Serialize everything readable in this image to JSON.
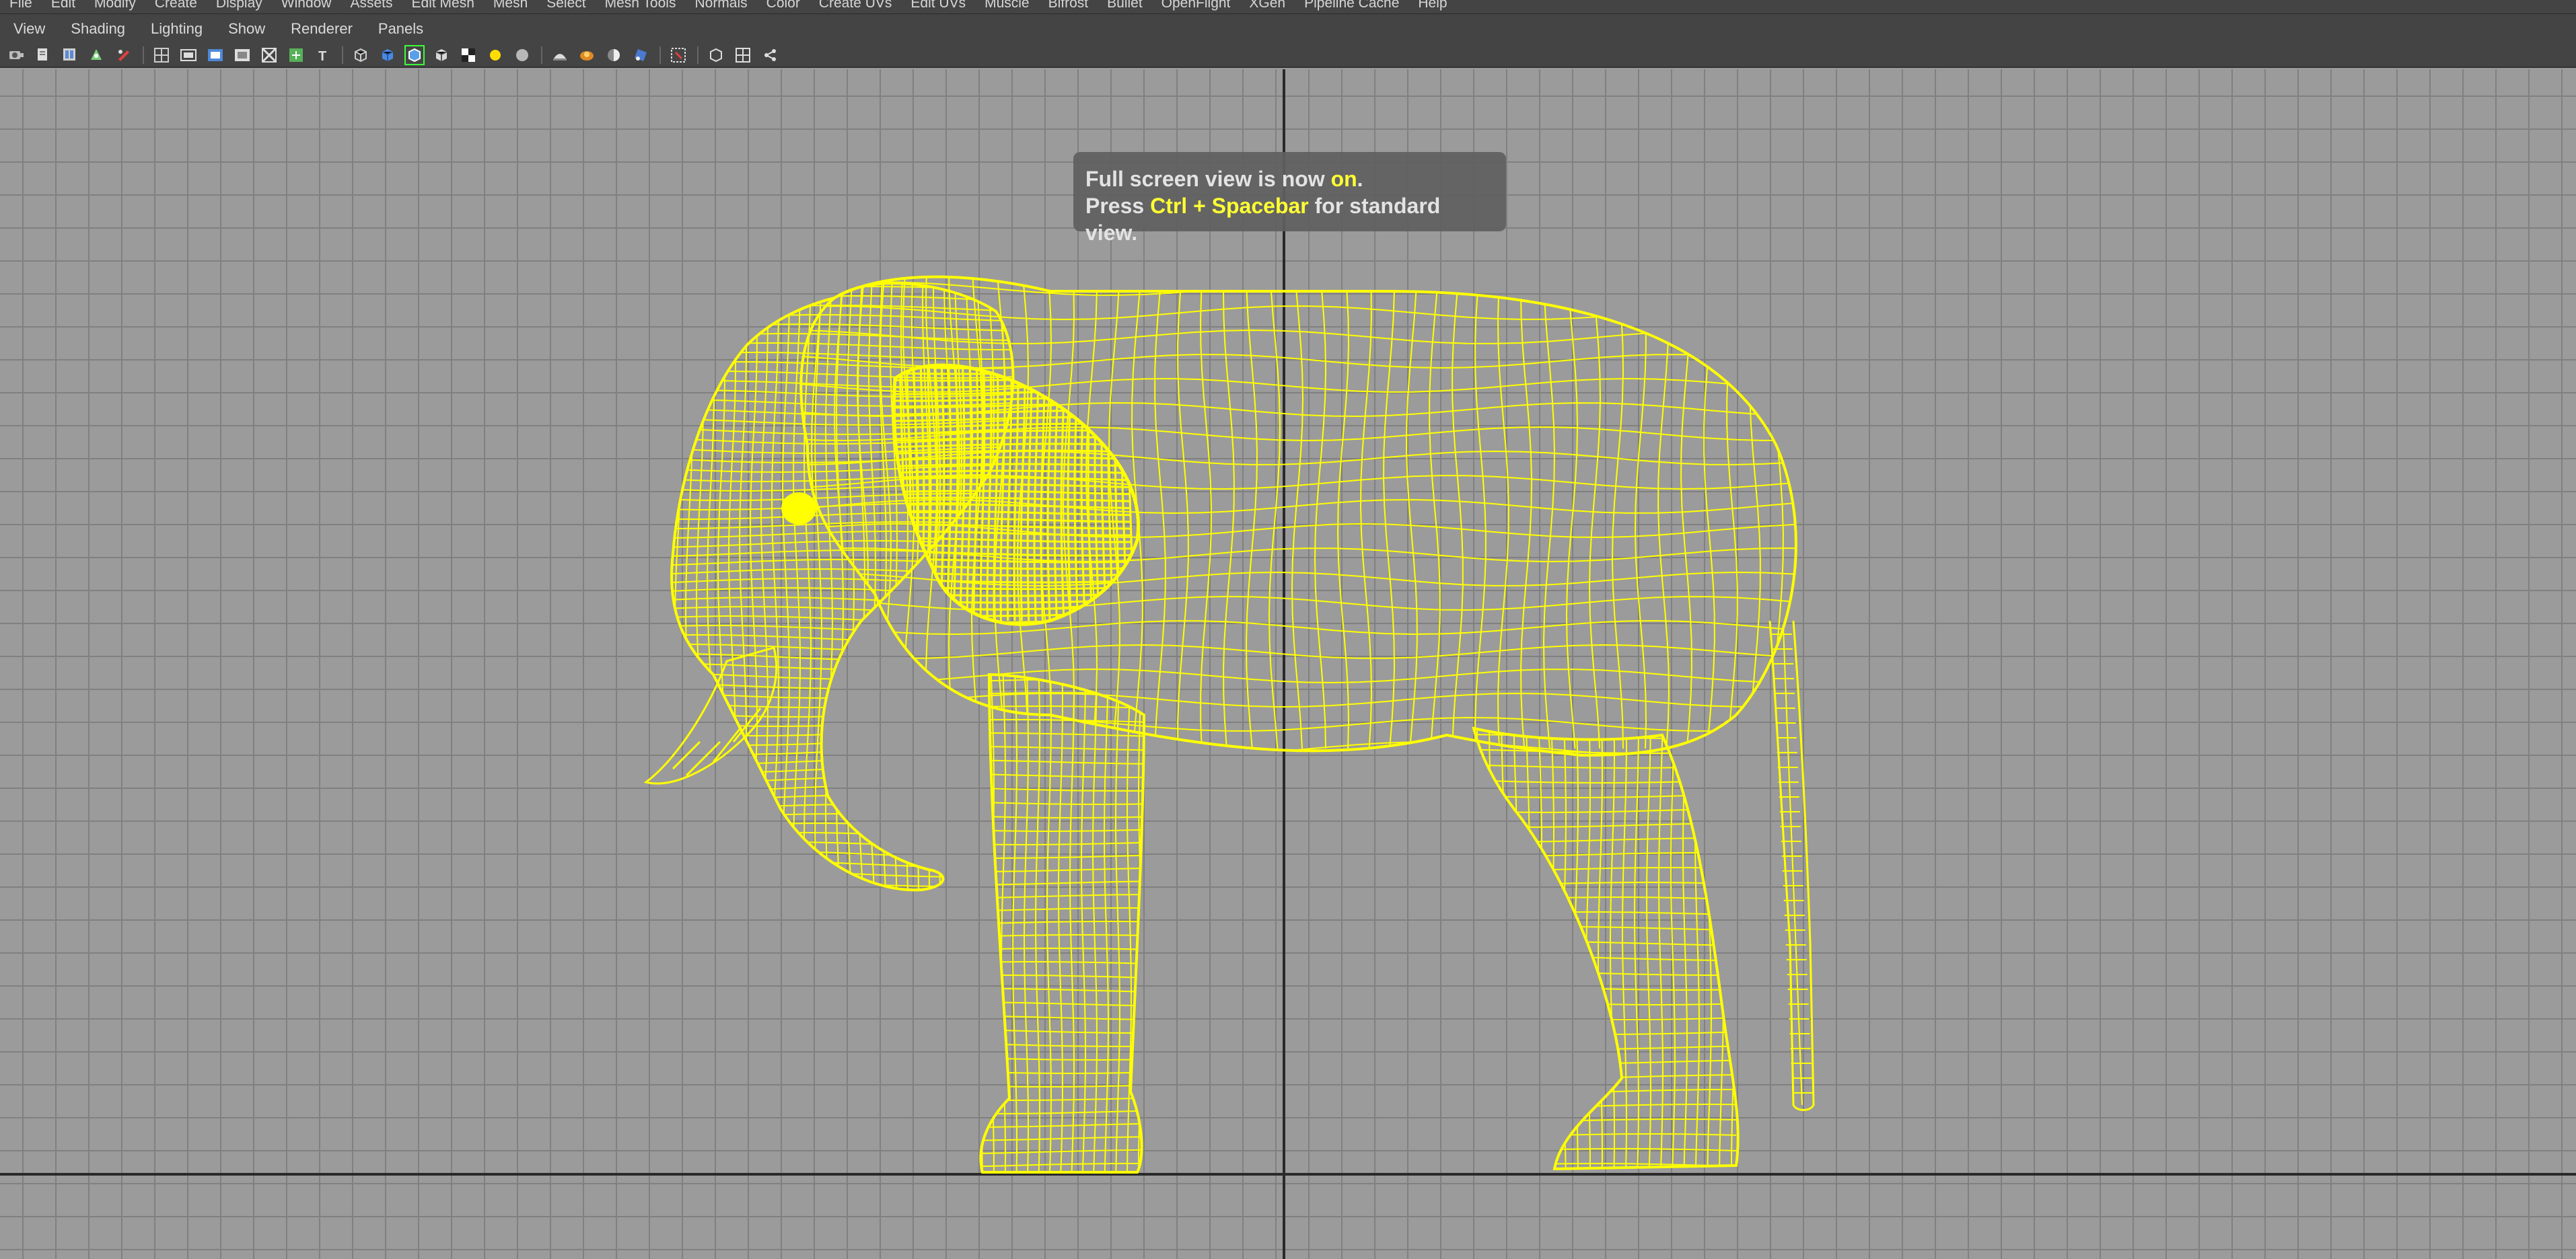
{
  "main_menu": [
    "File",
    "Edit",
    "Modify",
    "Create",
    "Display",
    "Window",
    "Assets",
    "Edit Mesh",
    "Mesh",
    "Select",
    "Mesh Tools",
    "Normals",
    "Color",
    "Create UVs",
    "Edit UVs",
    "Muscle",
    "Bifrost",
    "Bullet",
    "OpenFlight",
    "XGen",
    "Pipeline Cache",
    "Help"
  ],
  "panel_menu": [
    "View",
    "Shading",
    "Lighting",
    "Show",
    "Renderer",
    "Panels"
  ],
  "toolbar_groups": [
    [
      "camera-attributes-icon",
      "bookmark-icon",
      "image-plane-icon",
      "2d-pan-zoom-icon",
      "grease-pencil-icon"
    ],
    [
      "grid-icon",
      "film-gate-icon",
      "resolution-gate-icon",
      "gate-mask-icon",
      "field-chart-icon",
      "safe-action-icon",
      "safe-title-icon"
    ],
    [
      "wireframe-icon",
      "smooth-shade-icon",
      "wireframe-on-shaded-icon",
      "textured-icon",
      "use-all-lights-icon",
      "shadows-icon",
      "ambient-occlusion-icon"
    ],
    [
      "xray-icon",
      "xray-joints-icon",
      "backface-culling-icon",
      "motion-blur-icon"
    ],
    [
      "isolate-select-icon"
    ],
    [
      "single-view-icon",
      "four-view-icon",
      "camera-select-icon"
    ]
  ],
  "notification": {
    "line1_prefix": "Full screen view is now ",
    "line1_state": "on",
    "line1_suffix": ".",
    "line2_prefix": "Press ",
    "line2_keys": "Ctrl + Spacebar",
    "line2_suffix": " for standard view."
  },
  "colors": {
    "wireframe": "#ffff00",
    "viewport_bg": "#9b9b9b",
    "grid_line": "#808080",
    "axis_line": "#2a2a2a",
    "menu_bg": "#444444",
    "highlight_text": "#ffff33"
  },
  "viewport": {
    "display_mode": "wireframe",
    "object": "elephant mesh"
  }
}
